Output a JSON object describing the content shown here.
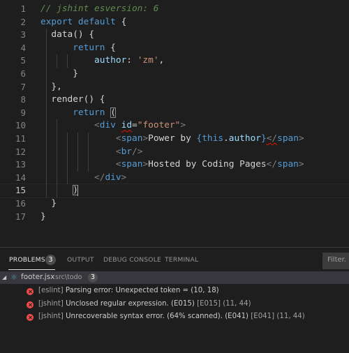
{
  "editor": {
    "lines": [
      {
        "num": "1",
        "tokens": [
          {
            "t": "// jshint esversion: 6",
            "c": "c-comment"
          }
        ]
      },
      {
        "num": "2",
        "tokens": [
          {
            "t": "export default ",
            "c": "c-kw"
          },
          {
            "t": "{",
            "c": "c-txt"
          }
        ]
      },
      {
        "num": "3",
        "tokens": [
          {
            "t": "  data() {",
            "c": "c-txt"
          }
        ]
      },
      {
        "num": "4",
        "tokens": [
          {
            "t": "      ",
            "c": "c-txt"
          },
          {
            "t": "return",
            "c": "c-kw"
          },
          {
            "t": " {",
            "c": "c-txt"
          }
        ]
      },
      {
        "num": "5",
        "tokens": [
          {
            "t": "          ",
            "c": "c-txt"
          },
          {
            "t": "author",
            "c": "c-prop"
          },
          {
            "t": ": ",
            "c": "c-txt"
          },
          {
            "t": "'zm'",
            "c": "c-str"
          },
          {
            "t": ",",
            "c": "c-txt"
          }
        ]
      },
      {
        "num": "6",
        "tokens": [
          {
            "t": "      }",
            "c": "c-txt"
          }
        ]
      },
      {
        "num": "7",
        "tokens": [
          {
            "t": "  },",
            "c": "c-txt"
          }
        ]
      },
      {
        "num": "8",
        "tokens": [
          {
            "t": "  render() {",
            "c": "c-txt"
          }
        ]
      },
      {
        "num": "9",
        "tokens": [
          {
            "t": "      ",
            "c": "c-txt"
          },
          {
            "t": "return",
            "c": "c-kw"
          },
          {
            "t": " ",
            "c": "c-txt"
          },
          {
            "t": "(",
            "c": "c-txt boxed"
          }
        ]
      },
      {
        "num": "10",
        "tokens": [
          {
            "t": "          ",
            "c": "c-txt"
          },
          {
            "t": "<",
            "c": "c-br"
          },
          {
            "t": "div",
            "c": "c-tag"
          },
          {
            "t": " ",
            "c": "c-txt"
          },
          {
            "t": "id",
            "c": "c-attr squiggle"
          },
          {
            "t": "=",
            "c": "c-txt"
          },
          {
            "t": "\"footer\"",
            "c": "c-str"
          },
          {
            "t": ">",
            "c": "c-br"
          }
        ]
      },
      {
        "num": "11",
        "tokens": [
          {
            "t": "              ",
            "c": "c-txt"
          },
          {
            "t": "<",
            "c": "c-br"
          },
          {
            "t": "span",
            "c": "c-tag"
          },
          {
            "t": ">",
            "c": "c-br"
          },
          {
            "t": "Power by ",
            "c": "c-txt"
          },
          {
            "t": "{",
            "c": "c-kw"
          },
          {
            "t": "this",
            "c": "c-kw"
          },
          {
            "t": ".",
            "c": "c-txt"
          },
          {
            "t": "author",
            "c": "c-prop"
          },
          {
            "t": "}",
            "c": "c-kw"
          },
          {
            "t": "</",
            "c": "c-br squiggle"
          },
          {
            "t": "span",
            "c": "c-tag"
          },
          {
            "t": ">",
            "c": "c-br"
          }
        ]
      },
      {
        "num": "12",
        "tokens": [
          {
            "t": "              ",
            "c": "c-txt"
          },
          {
            "t": "<",
            "c": "c-br"
          },
          {
            "t": "br",
            "c": "c-tag"
          },
          {
            "t": "/>",
            "c": "c-br"
          }
        ]
      },
      {
        "num": "13",
        "tokens": [
          {
            "t": "              ",
            "c": "c-txt"
          },
          {
            "t": "<",
            "c": "c-br"
          },
          {
            "t": "span",
            "c": "c-tag"
          },
          {
            "t": ">",
            "c": "c-br"
          },
          {
            "t": "Hosted by Coding Pages",
            "c": "c-txt"
          },
          {
            "t": "</",
            "c": "c-br"
          },
          {
            "t": "span",
            "c": "c-tag"
          },
          {
            "t": ">",
            "c": "c-br"
          }
        ]
      },
      {
        "num": "14",
        "tokens": [
          {
            "t": "          ",
            "c": "c-txt"
          },
          {
            "t": "</",
            "c": "c-br"
          },
          {
            "t": "div",
            "c": "c-tag"
          },
          {
            "t": ">",
            "c": "c-br"
          }
        ]
      },
      {
        "num": "15",
        "tokens": [
          {
            "t": "      ",
            "c": "c-txt"
          },
          {
            "t": ")",
            "c": "c-txt boxed"
          }
        ]
      },
      {
        "num": "16",
        "tokens": [
          {
            "t": "  }",
            "c": "c-txt"
          }
        ]
      },
      {
        "num": "17",
        "tokens": [
          {
            "t": "}",
            "c": "c-txt"
          }
        ]
      }
    ],
    "current_line": 15
  },
  "panel": {
    "tabs": [
      {
        "label": "PROBLEMS",
        "active": true
      },
      {
        "label": "OUTPUT",
        "active": false
      },
      {
        "label": "DEBUG CONSOLE",
        "active": false
      },
      {
        "label": "TERMINAL",
        "active": false
      }
    ],
    "problems_count": "3",
    "filter_placeholder": "Filter. E",
    "file": {
      "name": "footer.jsx",
      "path": "src\\todo",
      "count": "3",
      "icon": "react-icon"
    },
    "problems": [
      {
        "source": "[eslint]",
        "message": "Parsing error: Unexpected token = (10, 18)",
        "code": "",
        "location": ""
      },
      {
        "source": "[jshint]",
        "message": "Unclosed regular expression. (E015)",
        "code": "[E015]",
        "location": "(11, 44)"
      },
      {
        "source": "[jshint]",
        "message": "Unrecoverable syntax error. (64% scanned). (E041)",
        "code": "[E041]",
        "location": "(11, 44)"
      }
    ]
  },
  "colors": {
    "background": "#1e1e1e",
    "error": "#f14c4c",
    "keyword": "#569cd6",
    "string": "#ce9178",
    "comment": "#608b4e"
  }
}
